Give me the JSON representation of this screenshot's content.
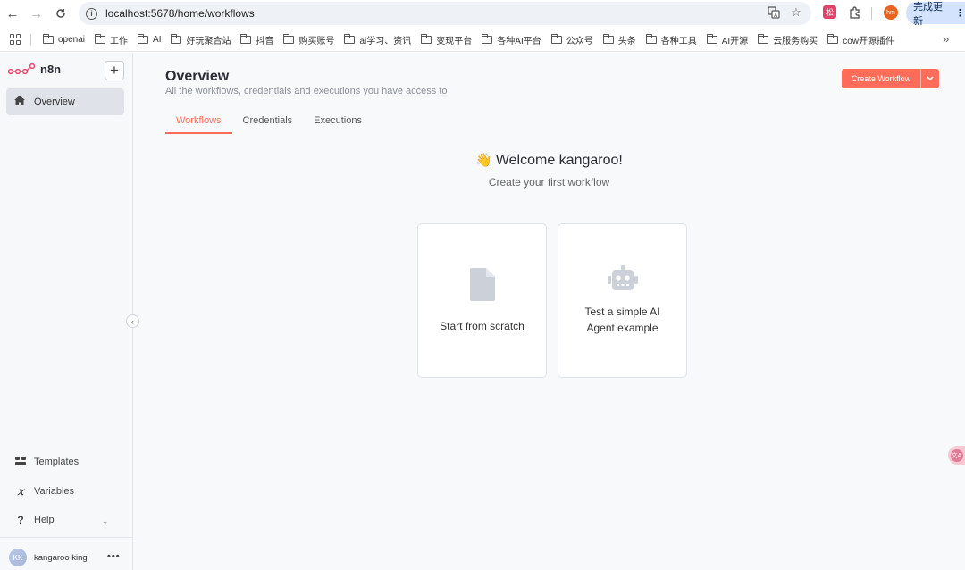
{
  "browser": {
    "url": "localhost:5678/home/workflows",
    "update_label": "完成更新",
    "profile_initials": "hm",
    "ext_label": "松",
    "bookmarks": [
      "openai",
      "工作",
      "AI",
      "好玩聚合站",
      "抖音",
      "购买账号",
      "ai学习、资讯",
      "变现平台",
      "各种AI平台",
      "公众号",
      "头条",
      "各种工具",
      "AI开源",
      "云服务购买",
      "cow开源插件"
    ]
  },
  "sidebar": {
    "logo": "n8n",
    "overview_label": "Overview",
    "templates_label": "Templates",
    "variables_label": "Variables",
    "help_label": "Help",
    "user_initials": "KK",
    "user_name": "kangaroo king"
  },
  "main": {
    "title": "Overview",
    "subtitle": "All the workflows, credentials and executions you have access to",
    "create_button": "Create Workflow",
    "tabs": [
      "Workflows",
      "Credentials",
      "Executions"
    ],
    "active_tab": "Workflows",
    "welcome": "Welcome kangaroo!",
    "welcome_emoji": "👋",
    "create_first": "Create your first workflow",
    "cards": [
      {
        "label": "Start from scratch",
        "icon": "file-icon"
      },
      {
        "label_line1": "Test a simple AI",
        "label_line2": "Agent example",
        "icon": "robot-icon"
      }
    ]
  },
  "colors": {
    "accent": "#ff6d5a",
    "sidebar_bg": "#f7f8fa",
    "main_bg": "#f8f9fb"
  }
}
